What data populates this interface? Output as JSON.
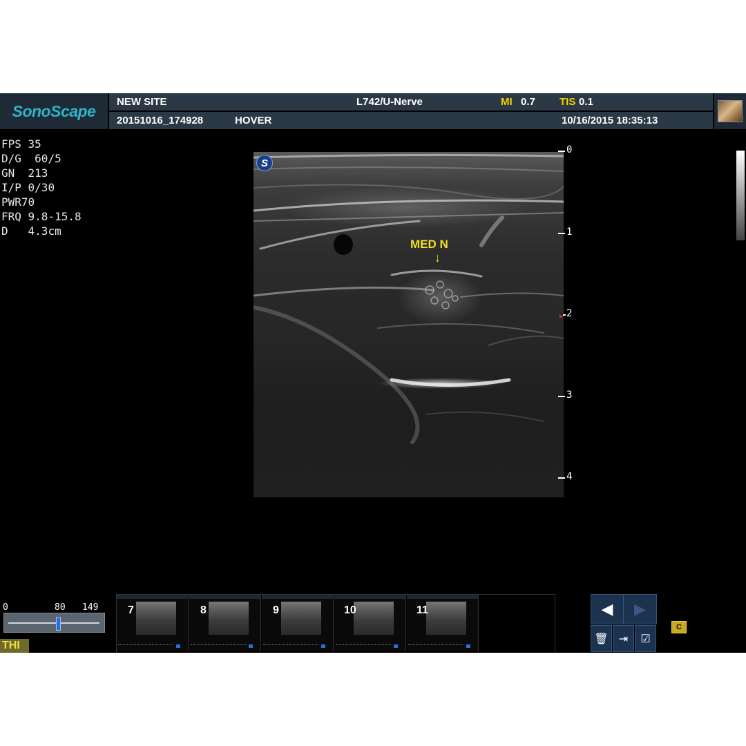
{
  "header": {
    "logo": "SonoScape",
    "site": "NEW SITE",
    "study_id": "20151016_174928",
    "hospital": "HOVER",
    "probe_preset": "L742/U-Nerve",
    "mi_label": "MI",
    "mi_value": "0.7",
    "tis_label": "TIS",
    "tis_value": "0.1",
    "datetime": "10/16/2015 18:35:13"
  },
  "params": [
    {
      "label": "FPS",
      "value": " 35"
    },
    {
      "label": "D/G",
      "value": "  60/5"
    },
    {
      "label": "GN",
      "value": "  213"
    },
    {
      "label": "I/P",
      "value": " 0/30"
    },
    {
      "label": "PWR",
      "value": "70"
    },
    {
      "label": "FRQ",
      "value": " 9.8-15.8"
    },
    {
      "label": "D",
      "value": "   4.3cm"
    }
  ],
  "image": {
    "badge": "S",
    "annotation": "MED N",
    "arrow": "↓",
    "depth_ticks": [
      "0",
      "1",
      "2",
      "3",
      "4"
    ],
    "focus_marker": "▸"
  },
  "slider": {
    "min": "0",
    "mid": "80",
    "max": "149",
    "value": 80
  },
  "mode_label": "THI",
  "thumbnails": [
    {
      "num": "7"
    },
    {
      "num": "8"
    },
    {
      "num": "9"
    },
    {
      "num": "10"
    },
    {
      "num": "11"
    }
  ],
  "controls": {
    "prev_icon": "◀",
    "next_icon": "▶",
    "delete_icon": "🗑",
    "export_icon": "⇥",
    "checklist_icon": "☑",
    "cine_label": "C"
  },
  "colors": {
    "header_bg": "#2b3846",
    "logo": "#2fb3c8",
    "annotation": "#f5e020",
    "accent_blue": "#2a6fd6"
  }
}
